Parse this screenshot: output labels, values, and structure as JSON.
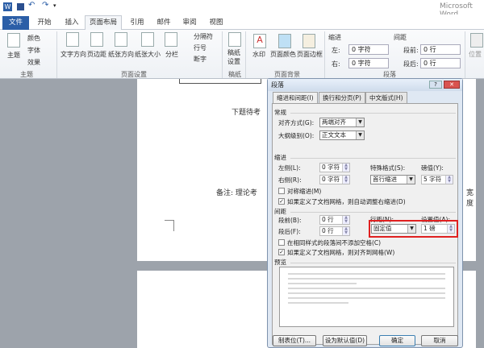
{
  "app": {
    "title": "Microsoft Word"
  },
  "tabs": [
    {
      "label": "文件"
    },
    {
      "label": "开始"
    },
    {
      "label": "插入"
    },
    {
      "label": "页面布局"
    },
    {
      "label": "引用"
    },
    {
      "label": "邮件"
    },
    {
      "label": "审阅"
    },
    {
      "label": "视图"
    }
  ],
  "ribbon": {
    "theme": {
      "btn": "主题",
      "colors": "颜色",
      "fonts": "字体",
      "effects": "效果",
      "group": "主题"
    },
    "page_setup": {
      "text_dir": "文字方向",
      "margins": "页边距",
      "orientation": "纸张方向",
      "size": "纸张大小",
      "columns": "分栏",
      "breaks": "分隔符",
      "line_numbers": "行号",
      "hyphenation": "断字",
      "group": "页面设置"
    },
    "draft": {
      "btn": "稿纸设置",
      "group": "稿纸"
    },
    "background": {
      "watermark": "水印",
      "color": "页面颜色",
      "borders": "页面边框",
      "group": "页面背景"
    },
    "paragraph": {
      "indent": "缩进",
      "left_label": "左:",
      "left_value": "0 字符",
      "right_label": "右:",
      "right_value": "0 字符",
      "spacing": "间距",
      "before_label": "段前:",
      "before_value": "0 行",
      "after_label": "段后:",
      "after_value": "0 行",
      "group": "段落"
    },
    "arrange": {
      "position": "位置"
    }
  },
  "document": {
    "line1": "下题待考",
    "line2": "备注: 理论考",
    "line2_tail": "宽度"
  },
  "dialog": {
    "title": "段落",
    "tabs": [
      "缩进和间距(I)",
      "换行和分页(P)",
      "中文版式(H)"
    ],
    "general": {
      "heading": "常规",
      "align_label": "对齐方式(G):",
      "align_value": "两端对齐",
      "outline_label": "大纲级别(O):",
      "outline_value": "正文文本"
    },
    "indent": {
      "heading": "缩进",
      "left_label": "左侧(L):",
      "left_value": "0 字符",
      "right_label": "右侧(R):",
      "right_value": "0 字符",
      "special_label": "特殊格式(S):",
      "special_value": "首行缩进",
      "by_label": "磅值(Y):",
      "by_value": "5 字符",
      "mirror": "对称缩进(M)",
      "mirror_checked": false,
      "auto_adjust": "如果定义了文档网格，则自动调整右缩进(D)",
      "auto_adjust_checked": true
    },
    "spacing": {
      "heading": "间距",
      "before_label": "段前(B):",
      "before_value": "0 行",
      "after_label": "段后(F):",
      "after_value": "0 行",
      "line_label": "行距(N):",
      "line_value": "固定值",
      "at_label": "设置值(A):",
      "at_value": "1 磅",
      "no_space": "在相同样式的段落间不添加空格(C)",
      "no_space_checked": false,
      "snap": "如果定义了文档网格，则对齐到网格(W)",
      "snap_checked": true
    },
    "preview": {
      "heading": "预览"
    },
    "buttons": {
      "tabs": "制表位(T)...",
      "default": "设为默认值(D)",
      "ok": "确定",
      "cancel": "取消"
    },
    "highlight_color": "#e02020"
  }
}
